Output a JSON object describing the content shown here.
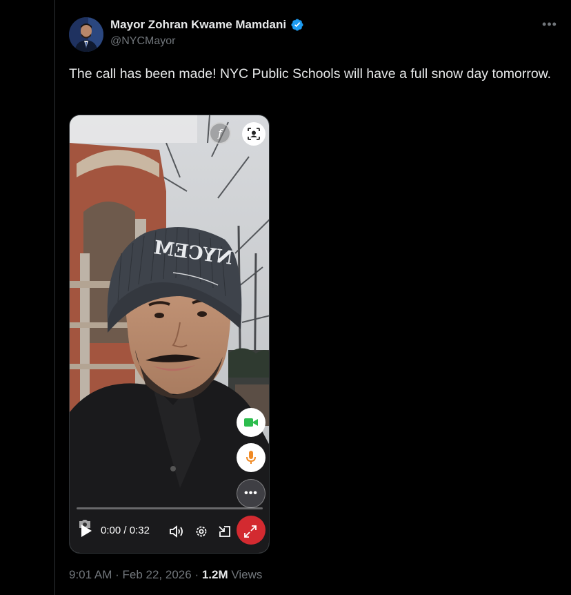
{
  "author": {
    "display_name": "Mayor Zohran Kwame Mamdani",
    "handle": "@NYCMayor",
    "verified": true,
    "verified_color": "#1d9bf0"
  },
  "tweet": {
    "text": "The call has been made! NYC Public Schools will have a full snow day tomorrow."
  },
  "video": {
    "hat_text": "NYCEM",
    "current_time": "0:00",
    "time_separator": "/",
    "duration": "0:32",
    "progress": 0,
    "overlay_f_label": "f",
    "end_call_color": "#d32a30",
    "video_btn_color": "#2dbd4e",
    "mic_btn_color": "#f08a24"
  },
  "meta": {
    "time": "9:01 AM",
    "date": "Feb 22, 2026",
    "views_count": "1.2M",
    "views_label": "Views"
  },
  "icons": [
    "verified-badge-icon",
    "more-icon",
    "play-icon",
    "volume-icon",
    "settings-icon",
    "picture-in-picture-icon",
    "fullscreen-icon",
    "camera-icon",
    "video-camera-icon",
    "microphone-icon",
    "ellipsis-icon",
    "face-frame-icon"
  ]
}
